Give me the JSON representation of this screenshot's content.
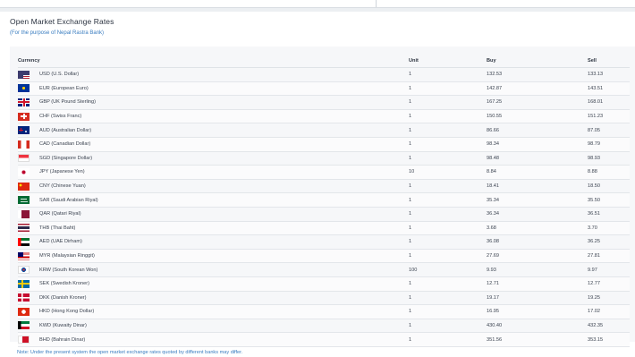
{
  "page": {
    "title": "Open Market Exchange Rates",
    "subtitle": "(For the purpose of Nepal Rastra Bank)",
    "note": "Note: Under the present system the open market exchange rates quoted by different banks may differ."
  },
  "table": {
    "headers": {
      "currency": "Currency",
      "unit": "Unit",
      "buy": "Buy",
      "sell": "Sell"
    },
    "rows": [
      {
        "currency": "USD (U.S. Dollar)",
        "unit": "1",
        "buy": "132.53",
        "sell": "133.13",
        "flag": "us-flag-icon"
      },
      {
        "currency": "EUR (European Euro)",
        "unit": "1",
        "buy": "142.87",
        "sell": "143.51",
        "flag": "eu-flag-icon"
      },
      {
        "currency": "GBP (UK Pound Sterling)",
        "unit": "1",
        "buy": "167.25",
        "sell": "168.01",
        "flag": "uk-flag-icon"
      },
      {
        "currency": "CHF (Swiss Franc)",
        "unit": "1",
        "buy": "150.55",
        "sell": "151.23",
        "flag": "ch-flag-icon"
      },
      {
        "currency": "AUD (Australian Dollar)",
        "unit": "1",
        "buy": "86.66",
        "sell": "87.05",
        "flag": "au-flag-icon"
      },
      {
        "currency": "CAD (Canadian Dollar)",
        "unit": "1",
        "buy": "98.34",
        "sell": "98.79",
        "flag": "ca-flag-icon"
      },
      {
        "currency": "SGD (Singapore Dollar)",
        "unit": "1",
        "buy": "98.48",
        "sell": "98.93",
        "flag": "sg-flag-icon"
      },
      {
        "currency": "JPY (Japanese Yen)",
        "unit": "10",
        "buy": "8.84",
        "sell": "8.88",
        "flag": "jp-flag-icon"
      },
      {
        "currency": "CNY (Chinese Yuan)",
        "unit": "1",
        "buy": "18.41",
        "sell": "18.50",
        "flag": "cn-flag-icon"
      },
      {
        "currency": "SAR (Saudi Arabian Riyal)",
        "unit": "1",
        "buy": "35.34",
        "sell": "35.50",
        "flag": "sa-flag-icon"
      },
      {
        "currency": "QAR (Qatari Riyal)",
        "unit": "1",
        "buy": "36.34",
        "sell": "36.51",
        "flag": "qa-flag-icon"
      },
      {
        "currency": "THB (Thai Baht)",
        "unit": "1",
        "buy": "3.68",
        "sell": "3.70",
        "flag": "th-flag-icon"
      },
      {
        "currency": "AED (UAE Dirham)",
        "unit": "1",
        "buy": "36.08",
        "sell": "36.25",
        "flag": "ae-flag-icon"
      },
      {
        "currency": "MYR (Malaysian Ringgit)",
        "unit": "1",
        "buy": "27.69",
        "sell": "27.81",
        "flag": "my-flag-icon"
      },
      {
        "currency": "KRW (South Korean Won)",
        "unit": "100",
        "buy": "9.93",
        "sell": "9.97",
        "flag": "kr-flag-icon"
      },
      {
        "currency": "SEK (Swedish Kroner)",
        "unit": "1",
        "buy": "12.71",
        "sell": "12.77",
        "flag": "se-flag-icon"
      },
      {
        "currency": "DKK (Danish Kroner)",
        "unit": "1",
        "buy": "19.17",
        "sell": "19.25",
        "flag": "dk-flag-icon"
      },
      {
        "currency": "HKD (Hong Kong Dollar)",
        "unit": "1",
        "buy": "16.95",
        "sell": "17.02",
        "flag": "hk-flag-icon"
      },
      {
        "currency": "KWD (Kuwaity Dinar)",
        "unit": "1",
        "buy": "430.40",
        "sell": "432.35",
        "flag": "kw-flag-icon"
      },
      {
        "currency": "BHD (Bahrain Dinar)",
        "unit": "1",
        "buy": "351.56",
        "sell": "353.15",
        "flag": "bh-flag-icon"
      }
    ]
  },
  "colors": {
    "page_bg": "#eceff2",
    "link_blue": "#3a7dc0",
    "text": "#3b4350"
  }
}
